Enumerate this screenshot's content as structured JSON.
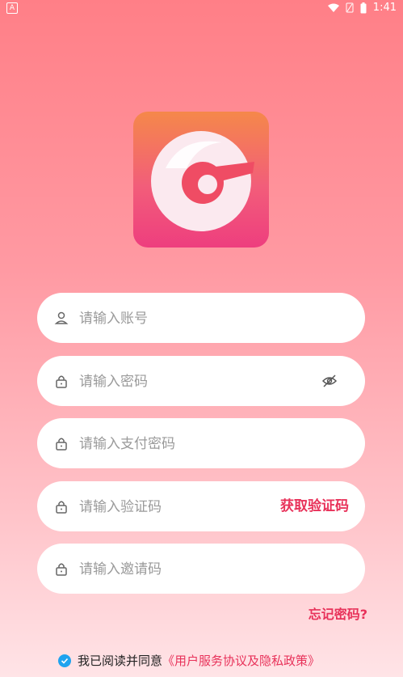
{
  "status": {
    "time": "1:41",
    "left_badge": "A"
  },
  "form": {
    "account_placeholder": "请输入账号",
    "password_placeholder": "请输入密码",
    "pay_password_placeholder": "请输入支付密码",
    "code_placeholder": "请输入验证码",
    "get_code_label": "获取验证码",
    "invite_placeholder": "请输入邀请码"
  },
  "forgot_label": "忘记密码?",
  "agreement": {
    "prefix": "我已阅读并同意",
    "link": "《用户服务协议及隐私政策》"
  },
  "colors": {
    "accent": "#e8325a",
    "check": "#1fa3ef"
  }
}
